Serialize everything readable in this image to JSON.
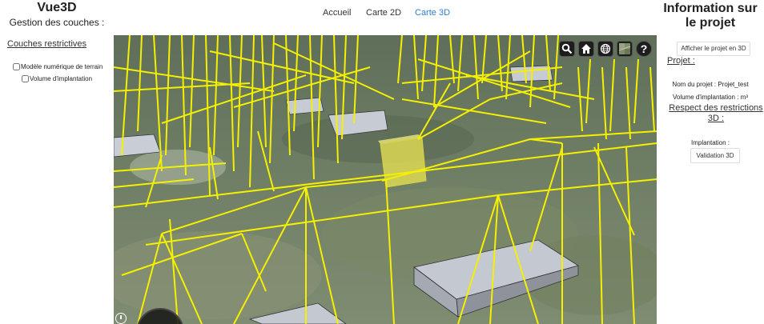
{
  "left_panel": {
    "title": "Vue3D",
    "subtitle": "Gestion des couches :",
    "section_link": "Couches restrictives",
    "layers": [
      {
        "label": "Modèle numérique de terrain",
        "checked": false
      },
      {
        "label": "Volume d'implantation",
        "checked": false
      }
    ]
  },
  "nav": {
    "items": [
      "Accueil",
      "Carte 2D",
      "Carte 3D"
    ],
    "active": "Carte 3D",
    "active_color": "#2d7dd2"
  },
  "map": {
    "toolbar": [
      "search-icon",
      "home-icon",
      "globe-icon",
      "layers-icon",
      "help-icon"
    ],
    "help_glyph": "?",
    "restriction_color": "#f5f000"
  },
  "right_panel": {
    "title": "Information sur le projet",
    "show_3d_button": "Afficher le projet en 3D",
    "projet_link": "Projet :",
    "project_name": "Nom du projet : Projet_test",
    "volume": "Volume d'implantation : m³",
    "restrictions_link": "Respect des restrictions 3D :",
    "implantation_label": "Implantation :",
    "validation_button": "Validation 3D"
  }
}
